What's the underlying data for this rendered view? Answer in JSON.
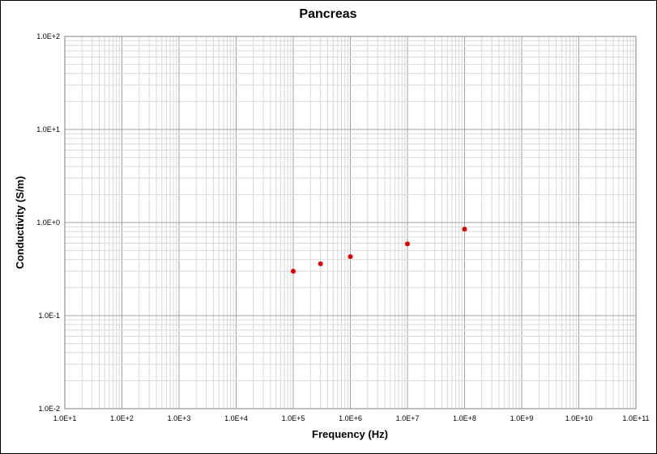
{
  "chart_data": {
    "type": "scatter",
    "title": "Pancreas",
    "xlabel": "Frequency (Hz)",
    "ylabel": "Conductivity (S/m)",
    "x_scale": "log",
    "y_scale": "log",
    "xlim": [
      10,
      100000000000
    ],
    "ylim": [
      0.01,
      100
    ],
    "grid": true,
    "x_ticks": [
      "1.0E+1",
      "1.0E+2",
      "1.0E+3",
      "1.0E+4",
      "1.0E+5",
      "1.0E+6",
      "1.0E+7",
      "1.0E+8",
      "1.0E+9",
      "1.0E+10",
      "1.0E+11"
    ],
    "y_ticks": [
      "1.0E-2",
      "1.0E-1",
      "1.0E+0",
      "1.0E+1",
      "1.0E+2"
    ],
    "series": [
      {
        "color": "#e00000",
        "points": [
          {
            "x": 100000,
            "y": 0.3
          },
          {
            "x": 300000,
            "y": 0.36
          },
          {
            "x": 1000000,
            "y": 0.43
          },
          {
            "x": 10000000,
            "y": 0.59
          },
          {
            "x": 100000000,
            "y": 0.85
          }
        ]
      }
    ]
  }
}
